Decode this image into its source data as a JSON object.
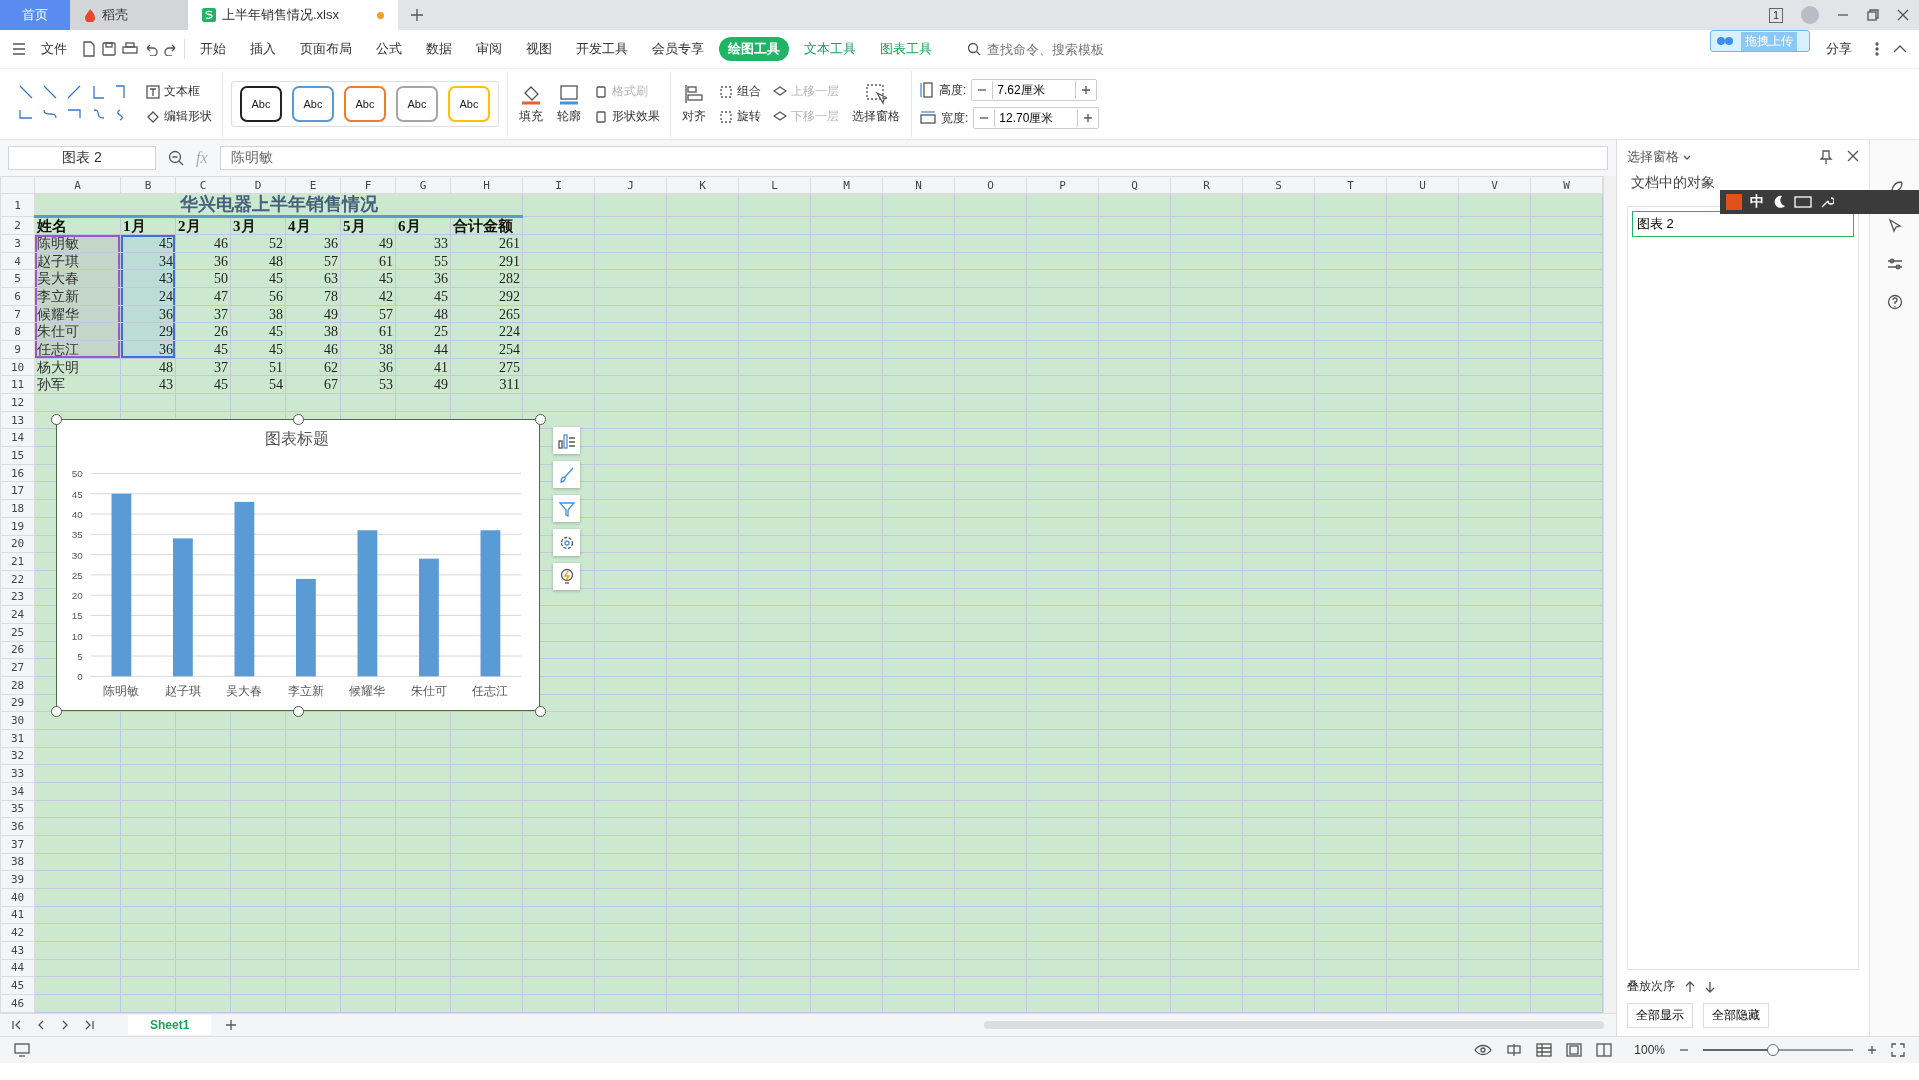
{
  "tabs": [
    {
      "label": "首页",
      "kind": "home",
      "selected": false,
      "modified": false
    },
    {
      "label": "稻壳",
      "kind": "app",
      "selected": false,
      "modified": false
    },
    {
      "label": "上半年销售情况.xlsx",
      "kind": "doc",
      "selected": true,
      "modified": true
    }
  ],
  "window": {
    "tab_count": "1",
    "upload": "拖拽上传"
  },
  "menu": {
    "file": "文件",
    "items": [
      {
        "label": "开始",
        "kind": "normal",
        "selected": false
      },
      {
        "label": "插入",
        "kind": "normal",
        "selected": false
      },
      {
        "label": "页面布局",
        "kind": "normal",
        "selected": false
      },
      {
        "label": "公式",
        "kind": "normal",
        "selected": false
      },
      {
        "label": "数据",
        "kind": "normal",
        "selected": false
      },
      {
        "label": "审阅",
        "kind": "normal",
        "selected": false
      },
      {
        "label": "视图",
        "kind": "normal",
        "selected": false
      },
      {
        "label": "开发工具",
        "kind": "normal",
        "selected": false
      },
      {
        "label": "会员专享",
        "kind": "normal",
        "selected": false
      },
      {
        "label": "绘图工具",
        "kind": "context",
        "selected": true
      },
      {
        "label": "文本工具",
        "kind": "context",
        "selected": false
      },
      {
        "label": "图表工具",
        "kind": "context",
        "selected": false
      }
    ],
    "search": {
      "placeholder": "查找命令、搜索模板"
    },
    "share": "分享"
  },
  "ribbon": {
    "text_buttons": [
      {
        "label": "文本框"
      },
      {
        "label": "编辑形状"
      }
    ],
    "styles": [
      {
        "label": "Abc",
        "color": "#222222"
      },
      {
        "label": "Abc",
        "color": "#5b9bd5"
      },
      {
        "label": "Abc",
        "color": "#ed7d31"
      },
      {
        "label": "Abc",
        "color": "#a5a5a5"
      },
      {
        "label": "Abc",
        "color": "#ffc000"
      }
    ],
    "large_buttons": [
      {
        "label": "填充",
        "kind": "fill"
      },
      {
        "label": "轮廓",
        "kind": "outline"
      }
    ],
    "effects": [
      {
        "label": "格式刷",
        "disabled": true
      },
      {
        "label": "形状效果",
        "disabled": false
      }
    ],
    "align": {
      "label": "对齐"
    },
    "arrange": [
      {
        "label": "组合",
        "disabled": false
      },
      {
        "label": "旋转",
        "disabled": false
      }
    ],
    "layers": [
      {
        "label": "上移一层",
        "disabled": true
      },
      {
        "label": "下移一层",
        "disabled": true
      }
    ],
    "selection_pane": {
      "label": "选择窗格"
    },
    "size": [
      {
        "label": "高度:",
        "value": "7.62厘米",
        "kind": "height"
      },
      {
        "label": "宽度:",
        "value": "12.70厘米",
        "kind": "width"
      }
    ]
  },
  "formula_bar": {
    "name_box": "图表 2",
    "fx": "fx",
    "value": "陈明敏"
  },
  "sheet": {
    "columns": [
      "A",
      "B",
      "C",
      "D",
      "E",
      "F",
      "G",
      "H",
      "I",
      "J",
      "K",
      "L",
      "M",
      "N",
      "O",
      "P",
      "Q",
      "R",
      "S",
      "T",
      "U",
      "V",
      "W"
    ],
    "row_numbers": [
      "1",
      "2",
      "3",
      "4",
      "5",
      "6",
      "7",
      "8",
      "9",
      "10",
      "11",
      "12",
      "13",
      "14",
      "15",
      "16",
      "17",
      "18",
      "19",
      "20",
      "21",
      "22",
      "23",
      "24",
      "25",
      "26",
      "27",
      "28",
      "29",
      "30",
      "31",
      "32",
      "33",
      "34",
      "35",
      "36",
      "37",
      "38",
      "39",
      "40",
      "41",
      "42",
      "43",
      "44",
      "45",
      "46"
    ],
    "title": "华兴电器上半年销售情况",
    "header": [
      "姓名",
      "1月",
      "2月",
      "3月",
      "4月",
      "5月",
      "6月",
      "合计金额"
    ],
    "rows": [
      {
        "name": "陈明敏",
        "values": [
          "45",
          "46",
          "52",
          "36",
          "49",
          "33"
        ],
        "total": "261",
        "selected": true
      },
      {
        "name": "赵子琪",
        "values": [
          "34",
          "36",
          "48",
          "57",
          "61",
          "55"
        ],
        "total": "291",
        "selected": true
      },
      {
        "name": "吴大春",
        "values": [
          "43",
          "50",
          "45",
          "63",
          "45",
          "36"
        ],
        "total": "282",
        "selected": true
      },
      {
        "name": "李立新",
        "values": [
          "24",
          "47",
          "56",
          "78",
          "42",
          "45"
        ],
        "total": "292",
        "selected": true
      },
      {
        "name": "候耀华",
        "values": [
          "36",
          "37",
          "38",
          "49",
          "57",
          "48"
        ],
        "total": "265",
        "selected": true
      },
      {
        "name": "朱仕可",
        "values": [
          "29",
          "26",
          "45",
          "38",
          "61",
          "25"
        ],
        "total": "224",
        "selected": true
      },
      {
        "name": "任志江",
        "values": [
          "36",
          "45",
          "45",
          "46",
          "38",
          "44"
        ],
        "total": "254",
        "selected": true
      },
      {
        "name": "杨大明",
        "values": [
          "48",
          "37",
          "51",
          "62",
          "36",
          "41"
        ],
        "total": "275",
        "selected": false
      },
      {
        "name": "孙军",
        "values": [
          "43",
          "45",
          "54",
          "67",
          "53",
          "49"
        ],
        "total": "311",
        "selected": false
      }
    ]
  },
  "chart": {
    "chart_data": {
      "type": "bar",
      "title": "图表标题",
      "categories": [
        "陈明敏",
        "赵子琪",
        "吴大春",
        "李立新",
        "候耀华",
        "朱仕可",
        "任志江"
      ],
      "series": [
        {
          "color": "#5b9bd5",
          "values": [
            45,
            34,
            43,
            24,
            36,
            29,
            36
          ]
        }
      ],
      "grid": true,
      "ylim": [
        0,
        50
      ],
      "yticks": [
        0,
        5,
        10,
        15,
        20,
        25,
        30,
        35,
        40,
        45,
        50
      ]
    }
  },
  "sheet_tabs": [
    {
      "label": "Sheet1",
      "selected": true
    }
  ],
  "panel": {
    "title": "选择窗格",
    "section": "文档中的对象",
    "objects": [
      {
        "label": "图表 2",
        "selected": true
      }
    ],
    "order_label": "叠放次序",
    "buttons": [
      "全部显示",
      "全部隐藏"
    ]
  },
  "ime": {
    "label": "中"
  },
  "status": {
    "zoom": "100%",
    "zoom_slider": {
      "level": 0.46
    }
  }
}
